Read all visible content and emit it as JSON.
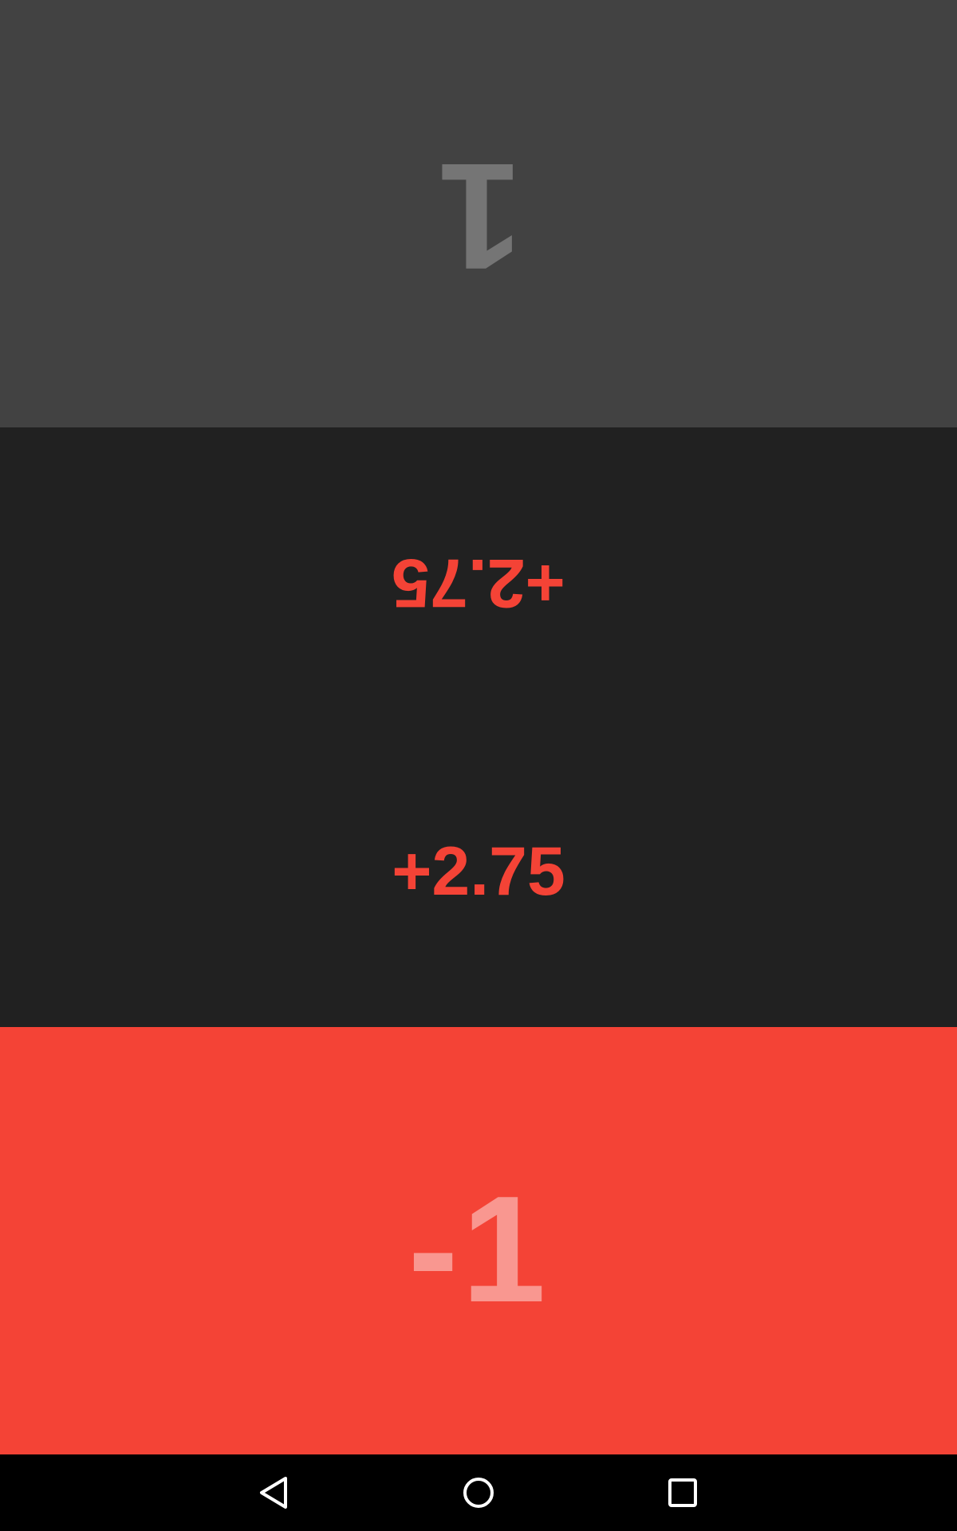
{
  "scoreboard": {
    "top_player": {
      "score": "1",
      "delta": "+2.75"
    },
    "bottom_player": {
      "score": "-1",
      "delta": "+2.75"
    }
  },
  "colors": {
    "top_panel_bg": "#424242",
    "middle_panel_bg": "#212121",
    "bottom_panel_bg": "#f44336",
    "accent": "#f44336",
    "nav_bar_bg": "#000000"
  },
  "nav_bar": {
    "icons": [
      "back-icon",
      "home-icon",
      "recents-icon"
    ]
  }
}
